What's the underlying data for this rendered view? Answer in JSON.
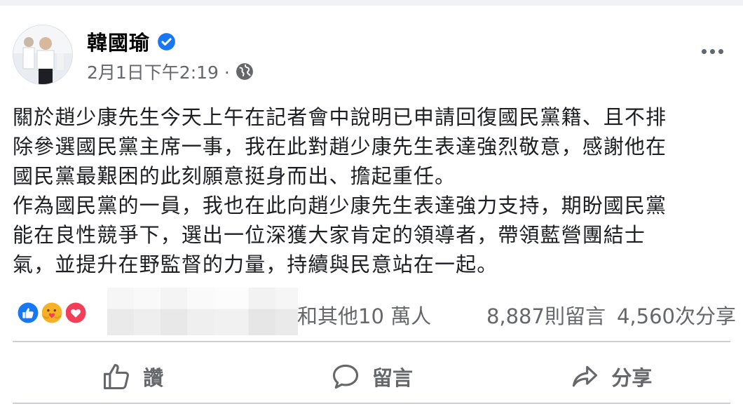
{
  "post": {
    "author": "韓國瑜",
    "timestamp": "2月1日下午2:19 ·",
    "text_lines": [
      "關於趙少康先生今天上午在記者會中說明已申請回復國民黨籍、且不排",
      "除參選國民黨主席一事，我在此對趙少康先生表達強烈敬意，感謝他在",
      "國民黨最艱困的此刻願意挺身而出、擔起重任。",
      "作為國民黨的一員，我也在此向趙少康先生表達強力支持，期盼國民黨",
      "能在良性競爭下，選出一位深獲大家肯定的領導者，帶領藍營團結士",
      "氣，並提升在野監督的力量，持續與民意站在一起。"
    ]
  },
  "engagement": {
    "others_text": "和其他10 萬人",
    "comments": "8,887則留言",
    "shares": "4,560次分享",
    "reaction_icons": [
      "like-icon",
      "care-icon",
      "love-icon"
    ]
  },
  "actions": {
    "like": "讚",
    "comment": "留言",
    "share": "分享"
  },
  "colors": {
    "like_blue": "#1877f2",
    "love_red": "#f33e58",
    "care_yellow": "#f7b125",
    "secondary_text": "#65676b"
  }
}
